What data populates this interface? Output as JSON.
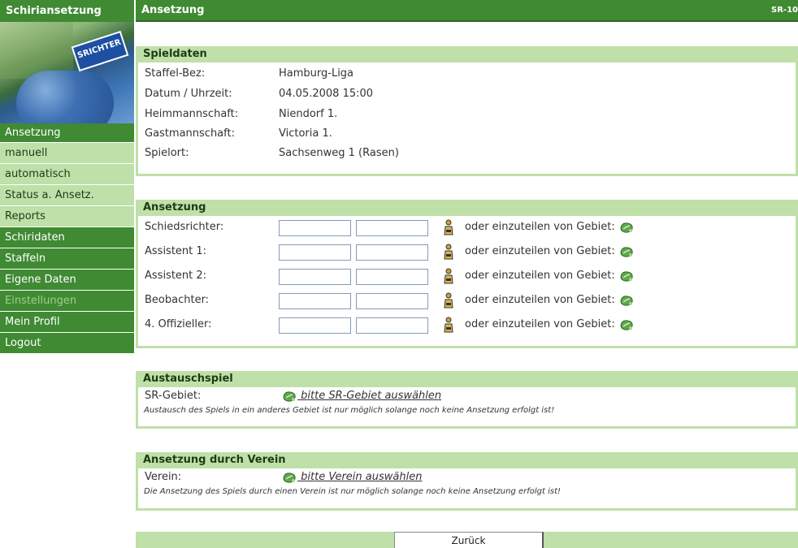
{
  "sidebar": {
    "app_title": "Schiriansetzung",
    "image_text": "SRICHTER",
    "items": [
      {
        "label": "Ansetzung"
      },
      {
        "label": "manuell"
      },
      {
        "label": "automatisch"
      },
      {
        "label": "Status a. Ansetz."
      },
      {
        "label": "Reports"
      },
      {
        "label": "Schiridaten"
      },
      {
        "label": "Staffeln"
      },
      {
        "label": "Eigene Daten"
      },
      {
        "label": "Einstellungen"
      },
      {
        "label": "Mein Profil"
      },
      {
        "label": "Logout"
      }
    ]
  },
  "header": {
    "title": "Ansetzung",
    "code": "SR-10"
  },
  "spieldaten": {
    "title": "Spieldaten",
    "rows": [
      {
        "label": "Staffel-Bez:",
        "value": "Hamburg-Liga"
      },
      {
        "label": "Datum / Uhrzeit:",
        "value": "04.05.2008 15:00"
      },
      {
        "label": "Heimmannschaft:",
        "value": "Niendorf 1."
      },
      {
        "label": "Gastmannschaft:",
        "value": "Victoria 1."
      },
      {
        "label": "Spielort:",
        "value": "Sachsenweg 1 (Rasen)"
      }
    ]
  },
  "ansetzung": {
    "title": "Ansetzung",
    "assign_text": "oder einzuteilen von Gebiet:",
    "rows": [
      {
        "label": "Schiedsrichter:",
        "field1": "",
        "field2": ""
      },
      {
        "label": "Assistent 1:",
        "field1": "",
        "field2": ""
      },
      {
        "label": "Assistent 2:",
        "field1": "",
        "field2": ""
      },
      {
        "label": "Beobachter:",
        "field1": "",
        "field2": ""
      },
      {
        "label": "4. Offizieller:",
        "field1": "",
        "field2": ""
      }
    ]
  },
  "austausch": {
    "title": "Austauschspiel",
    "label": "SR-Gebiet:",
    "link": " bitte SR-Gebiet auswählen",
    "note": "Austausch des Spiels in ein anderes Gebiet ist nur möglich solange noch keine Ansetzung erfolgt ist!"
  },
  "verein": {
    "title": "Ansetzung durch Verein",
    "label": "Verein:",
    "link": " bitte Verein auswählen",
    "note": "Die Ansetzung des Spiels durch einen Verein ist nur möglich solange noch keine Ansetzung erfolgt ist!"
  },
  "footer": {
    "back_label": "Zurück"
  },
  "colors": {
    "dark_green": "#3f8a33",
    "light_green": "#bfe0a9",
    "disabled_text": "#9ccf8b"
  },
  "icons": {
    "person": "person-icon",
    "area": "leaf-icon"
  }
}
